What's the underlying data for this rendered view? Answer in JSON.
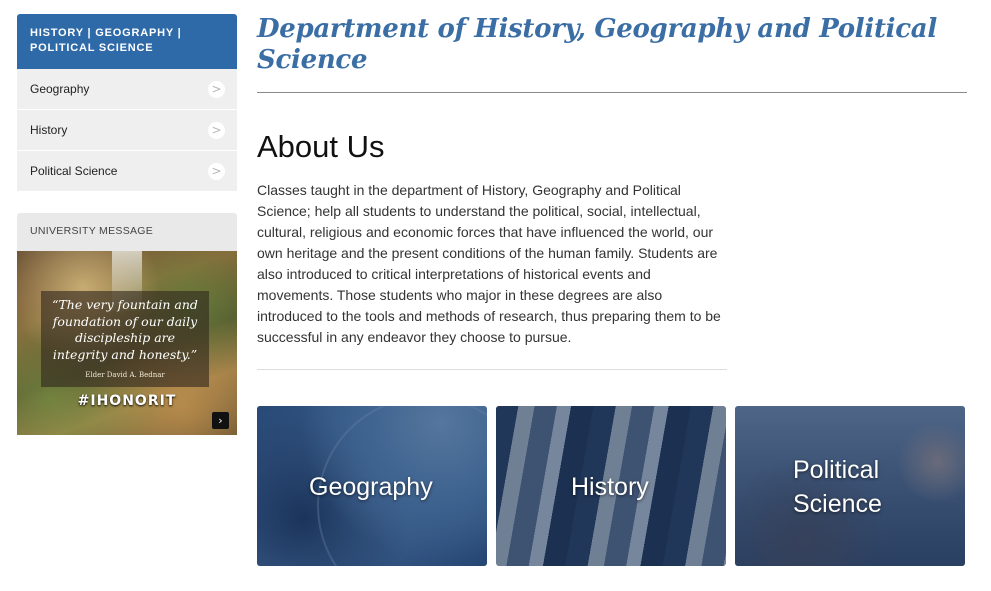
{
  "sidebar": {
    "header": "HISTORY | GEOGRAPHY | POLITICAL SCIENCE",
    "items": [
      {
        "label": "Geography",
        "chevron": ">"
      },
      {
        "label": "History",
        "chevron": ">"
      },
      {
        "label": "Political Science",
        "chevron": ">"
      }
    ],
    "message": {
      "header": "UNIVERSITY MESSAGE",
      "quote": "“The very fountain and foundation of our daily discipleship are integrity and honesty.”",
      "author": "Elder David A. Bednar",
      "hashtag": "#IHONORIT",
      "next_icon": "›"
    }
  },
  "main": {
    "title": "Department of History, Geography and Political Science",
    "about_heading": "About Us",
    "about_text": "Classes taught in the department of History, Geography and Political Science; help all students to understand the political, social, intellectual, cultural, religious and economic forces that have influenced the world, our own heritage and the present conditions of the human family. Students are also introduced to critical interpretations of historical events and movements. Those students who major in these degrees are also introduced to the tools and methods of research, thus preparing them to be successful in any endeavor they choose to pursue.",
    "tiles": [
      {
        "label": "Geography"
      },
      {
        "label": "History"
      },
      {
        "label": "Political Science"
      }
    ]
  },
  "colors": {
    "accent": "#2f6aa8",
    "title": "#3a6ea5"
  }
}
